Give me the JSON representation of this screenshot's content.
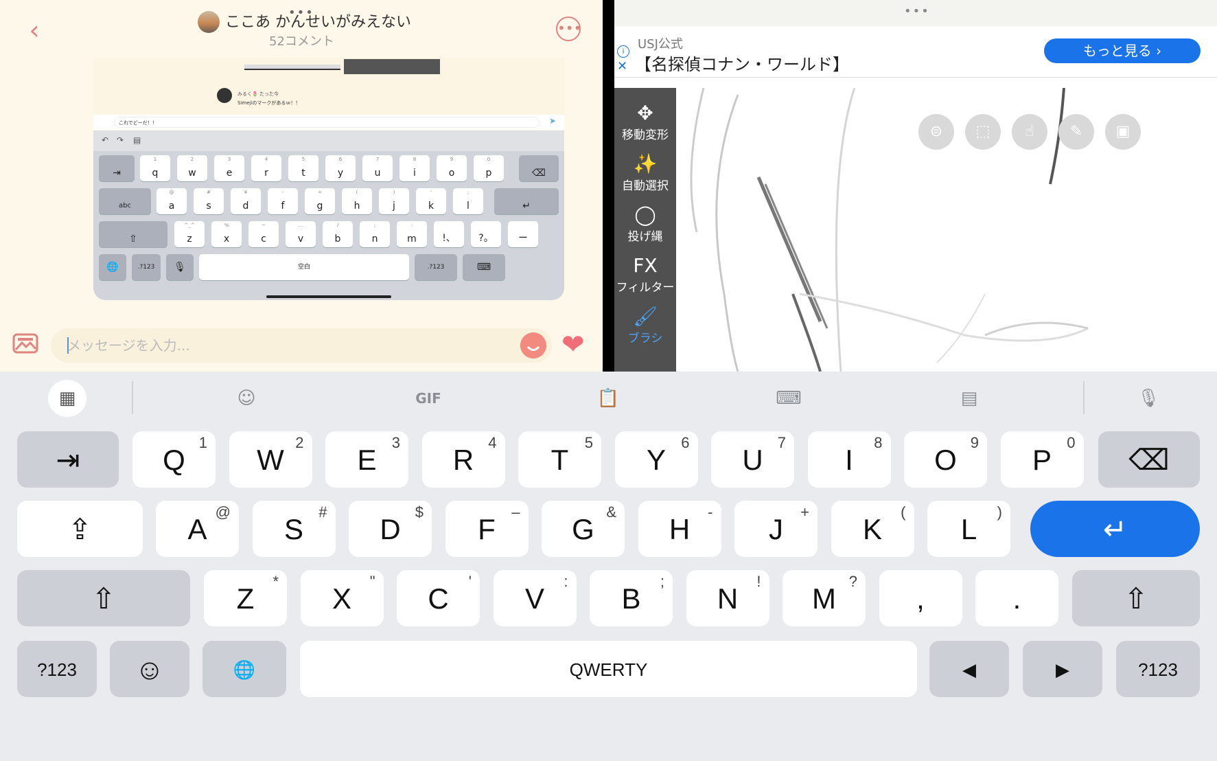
{
  "chat": {
    "back_icon": "back-chevron-icon",
    "title": "ここあ かんせいがみえない",
    "subtitle": "52コメント",
    "pane_handle": "•••",
    "more_icon": "more-dots-icon",
    "embedded_screenshot": {
      "poster_name": "みるく🌷 たった今",
      "poster_message": "Simejiのマークがあるｗ！！",
      "input_value": "これでどーだ！！",
      "keyboard_rows": [
        [
          {
            "s": "1",
            "m": "q"
          },
          {
            "s": "2",
            "m": "w"
          },
          {
            "s": "3",
            "m": "e"
          },
          {
            "s": "4",
            "m": "r"
          },
          {
            "s": "5",
            "m": "t"
          },
          {
            "s": "6",
            "m": "y"
          },
          {
            "s": "7",
            "m": "u"
          },
          {
            "s": "8",
            "m": "i"
          },
          {
            "s": "9",
            "m": "o"
          },
          {
            "s": "0",
            "m": "p"
          }
        ],
        [
          {
            "s": "@",
            "m": "a"
          },
          {
            "s": "#",
            "m": "s"
          },
          {
            "s": "¥",
            "m": "d"
          },
          {
            "s": "-",
            "m": "f"
          },
          {
            "s": "=",
            "m": "g"
          },
          {
            "s": "(",
            "m": "h"
          },
          {
            "s": ")",
            "m": "j"
          },
          {
            "s": "'",
            "m": "k"
          },
          {
            "s": ";",
            "m": "l"
          }
        ],
        [
          {
            "s": "^_^",
            "m": "z"
          },
          {
            "s": "%",
            "m": "x"
          },
          {
            "s": "~",
            "m": "c"
          },
          {
            "s": "…",
            "m": "v"
          },
          {
            "s": "/",
            "m": "b"
          },
          {
            "s": ";",
            "m": "n"
          },
          {
            "s": ":",
            "m": "m"
          },
          {
            "s": "",
            "m": "!、"
          },
          {
            "s": "",
            "m": "?。"
          },
          {
            "s": "",
            "m": "ー"
          }
        ]
      ],
      "abc_label": "abc",
      "num_label": ".?123",
      "space_label": "空白"
    },
    "message_placeholder": "メッセージを入力...",
    "gallery_icon": "image-icon",
    "emoji_icon": "smile-face-icon",
    "heart_icon": "heart-icon"
  },
  "drawing": {
    "pane_handle": "•••",
    "ad": {
      "sponsor": "USJ公式",
      "title": "【名探偵コナン・ワールド】",
      "cta": "もっと見る ›",
      "info_icon": "info-icon",
      "close_icon": "close-icon"
    },
    "tools": [
      {
        "icon": "move-arrows-icon",
        "glyph": "✥",
        "label": "移動変形"
      },
      {
        "icon": "magic-wand-icon",
        "glyph": "✨",
        "label": "自動選択"
      },
      {
        "icon": "lasso-icon",
        "glyph": "◯",
        "label": "投げ縄"
      },
      {
        "icon": "fx-icon",
        "glyph": "FX",
        "label": "フィルター"
      },
      {
        "icon": "brush-icon",
        "glyph": "🖌",
        "label": "ブラシ"
      }
    ],
    "fabs": [
      "toggle-icon",
      "selection-icon",
      "hand-icon",
      "ruler-icon",
      "image-icon"
    ],
    "accent_color": "#4aa3f5"
  },
  "keyboard": {
    "toolbar": [
      "apps-grid-icon",
      "sticker-icon",
      "GIF",
      "clipboard-icon",
      "keyboard-icon",
      "calculator-keyboard-icon",
      "mic-icon"
    ],
    "row1": [
      {
        "m": "Q",
        "s": "1"
      },
      {
        "m": "W",
        "s": "2"
      },
      {
        "m": "E",
        "s": "3"
      },
      {
        "m": "R",
        "s": "4"
      },
      {
        "m": "T",
        "s": "5"
      },
      {
        "m": "Y",
        "s": "6"
      },
      {
        "m": "U",
        "s": "7"
      },
      {
        "m": "I",
        "s": "8"
      },
      {
        "m": "O",
        "s": "9"
      },
      {
        "m": "P",
        "s": "0"
      }
    ],
    "row2": [
      {
        "m": "A",
        "s": "@"
      },
      {
        "m": "S",
        "s": "#"
      },
      {
        "m": "D",
        "s": "$"
      },
      {
        "m": "F",
        "s": "–"
      },
      {
        "m": "G",
        "s": "&"
      },
      {
        "m": "H",
        "s": "-"
      },
      {
        "m": "J",
        "s": "+"
      },
      {
        "m": "K",
        "s": "("
      },
      {
        "m": "L",
        "s": ")"
      }
    ],
    "row3": [
      {
        "m": "Z",
        "s": "*"
      },
      {
        "m": "X",
        "s": "\""
      },
      {
        "m": "C",
        "s": "'"
      },
      {
        "m": "V",
        "s": ":"
      },
      {
        "m": "B",
        "s": ";"
      },
      {
        "m": "N",
        "s": "!"
      },
      {
        "m": "M",
        "s": "?"
      },
      {
        "m": ",",
        "s": ""
      },
      {
        "m": ".",
        "s": ""
      }
    ],
    "tab_glyph": "⇥",
    "backspace_glyph": "⌫",
    "caps_glyph": "⇪",
    "enter_glyph": "↵",
    "shift_glyph": "⇧",
    "num_label": "?123",
    "emoji_glyph": "☺",
    "globe_glyph": "🌐",
    "space_label": "QWERTY",
    "left_glyph": "◀",
    "right_glyph": "▶",
    "accent_color": "#1a73e8"
  }
}
